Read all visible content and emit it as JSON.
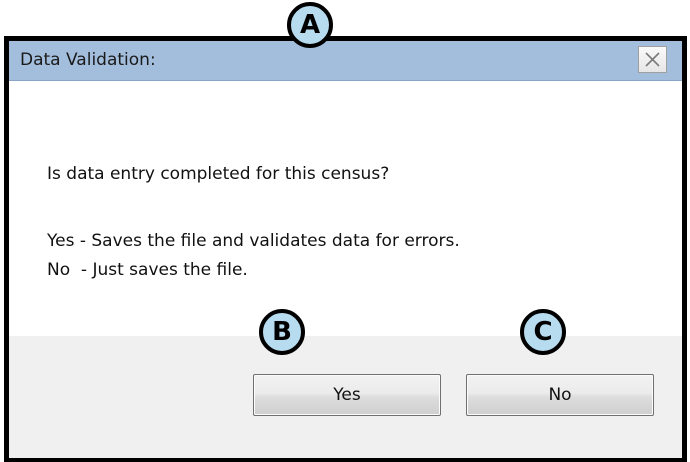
{
  "dialog": {
    "title": "Data Validation:",
    "close_icon": "close-icon",
    "question": "Is data entry completed for this census?",
    "yes_description": "Yes - Saves the file and validates data for errors.",
    "no_description": "No  - Just saves the file."
  },
  "buttons": {
    "yes_label": "Yes",
    "no_label": "No"
  },
  "callouts": {
    "a": "A",
    "b": "B",
    "c": "C"
  },
  "colors": {
    "titlebar": "#a3bedc",
    "callout_fill": "#b7dcf0",
    "footer": "#f0f0f0",
    "frame_border": "#000000"
  }
}
